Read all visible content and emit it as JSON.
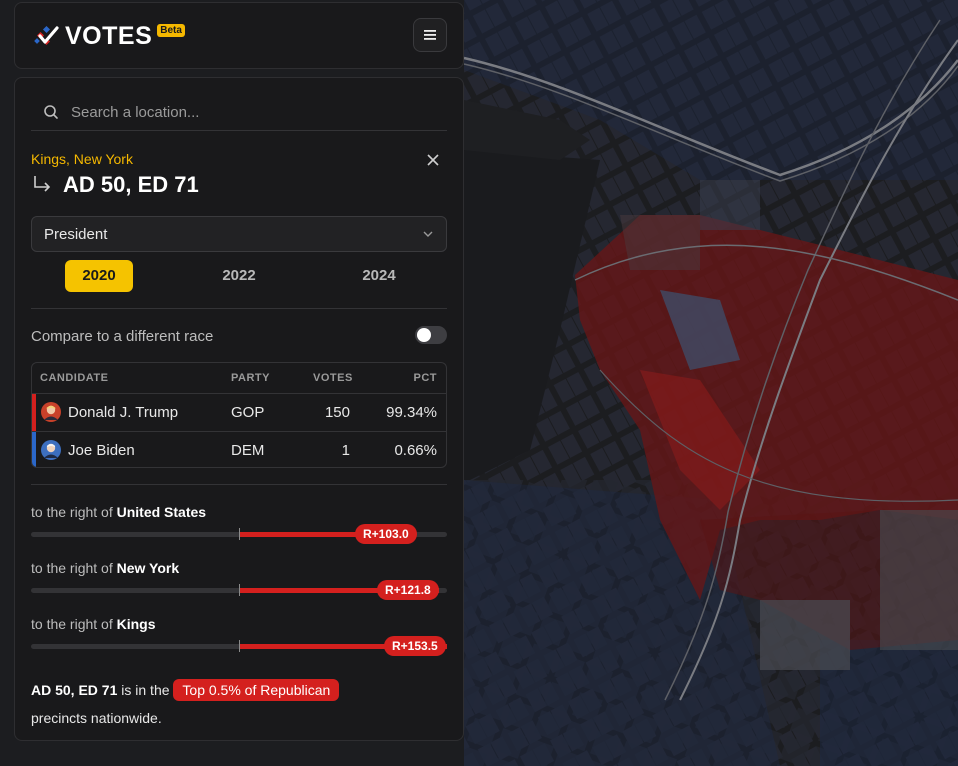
{
  "app": {
    "name": "VOTES",
    "badge": "Beta"
  },
  "header": {
    "menu_icon": "hamburger-menu-icon"
  },
  "search": {
    "placeholder": "Search a location..."
  },
  "location": {
    "county": "Kings, New York",
    "district": "AD 50, ED 71"
  },
  "race": {
    "selected": "President"
  },
  "years": {
    "items": [
      "2020",
      "2022",
      "2024"
    ],
    "active": "2020"
  },
  "compare": {
    "label": "Compare to a different race",
    "enabled": false
  },
  "results": {
    "headers": {
      "candidate": "CANDIDATE",
      "party": "PARTY",
      "votes": "VOTES",
      "pct": "PCT"
    },
    "rows": [
      {
        "name": "Donald J. Trump",
        "party": "GOP",
        "votes": "150",
        "pct": "99.34%",
        "color": "#d4201e"
      },
      {
        "name": "Joe Biden",
        "party": "DEM",
        "votes": "1",
        "pct": "0.66%",
        "color": "#2b67c9"
      }
    ]
  },
  "comparisons": [
    {
      "prefix": "to the right of",
      "place": "United States",
      "margin": "R+103.0"
    },
    {
      "prefix": "to the right of",
      "place": "New York",
      "margin": "R+121.8"
    },
    {
      "prefix": "to the right of",
      "place": "Kings",
      "margin": "R+153.5"
    }
  ],
  "summary": {
    "district": "AD 50, ED 71",
    "middle": "is in the",
    "badge": "Top 0.5% of Republican",
    "end": "precincts nationwide."
  },
  "colors": {
    "accent": "#f5c300",
    "republican": "#d4201e",
    "democrat": "#2b67c9"
  }
}
